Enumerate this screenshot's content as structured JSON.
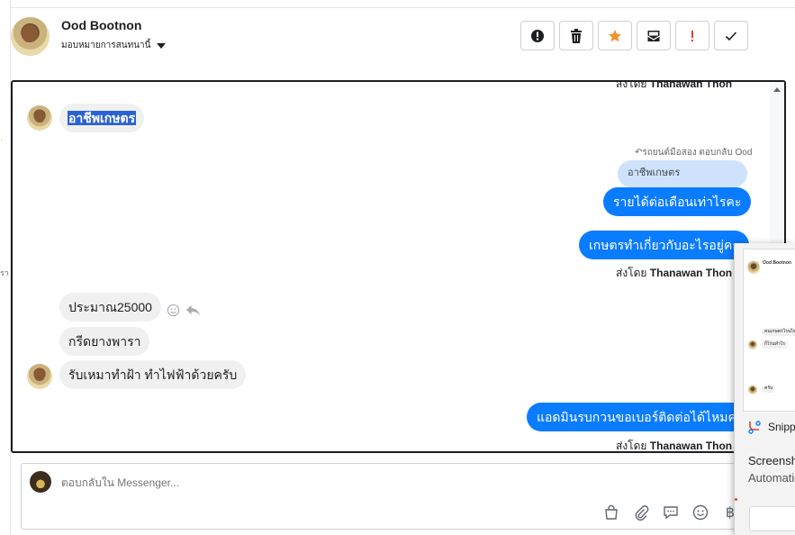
{
  "header": {
    "contact_name": "Ood Bootnon",
    "assign_label": "มอบหมายการสนทนานี้",
    "toolbar": [
      {
        "name": "mark-spam-button",
        "icon": "exclamation-circle-icon"
      },
      {
        "name": "delete-button",
        "icon": "trash-icon"
      },
      {
        "name": "star-button",
        "icon": "star-icon"
      },
      {
        "name": "mark-unread-button",
        "icon": "envelope-icon"
      },
      {
        "name": "important-button",
        "icon": "exclamation-icon"
      },
      {
        "name": "done-button",
        "icon": "check-icon"
      }
    ]
  },
  "conversation": {
    "top_sent_by_prefix": "ส่งโดย",
    "top_sent_by_name": "Thanawan Thon",
    "msg1": "อาชีพเกษตร",
    "reply_meta": "↶รถยนต์มือสอง ตอบกลับ Ood",
    "quoted": "อาชีพเกษตร",
    "out1": "รายได้ต่อเดือนเท่าไรคะ",
    "out2": "เกษตรทำเกี่ยวกับอะไรอยู่คะ",
    "sent_by_prefix": "ส่งโดย",
    "sent_by_name": "Thanawan Thon",
    "in2": "ประมาณ25000",
    "in3": "กรีดยางพารา",
    "in4": "รับเหมาทำฝ้า ทำไฟฟ้าด้วยครับ",
    "out3": "แอดมินรบกวนขอเบอร์ติดต่อได้ไหมคะ",
    "bottom_sent_by_prefix": "ส่งโดย",
    "bottom_sent_by_name": "Thanawan Thon"
  },
  "composer": {
    "placeholder": "ตอบกลับใน Messenger..."
  },
  "left_rail": {
    "fragment": "รา"
  },
  "popup": {
    "thumb_name": "Ood Bootnon",
    "thumb_msg1": "คนเกษตรไรนไทย",
    "thumb_msg2": "ก็ไร่นทำไร",
    "thumb_msg3": "ครับ",
    "app_name": "Snipping Tool",
    "notif_title": "Screenshot copied to clipboard",
    "notif_body": "Automatically saved to screenshots folder"
  },
  "colors": {
    "accent": "#0a7cff",
    "selection": "#2a62d4",
    "star": "#f5922f",
    "important": "#e4402f"
  }
}
